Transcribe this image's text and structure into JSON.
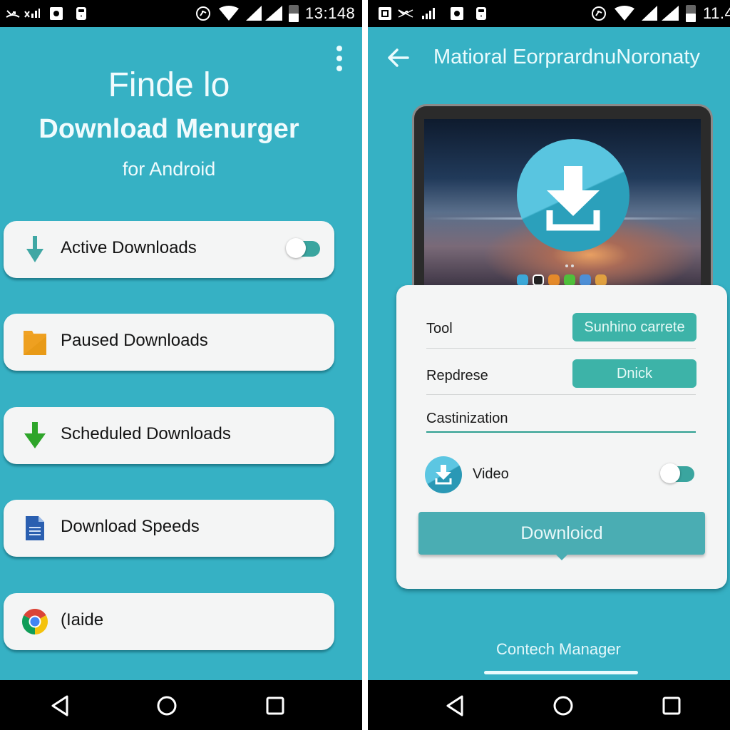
{
  "left_screen": {
    "status_bar": {
      "left_icons": [
        "missed-call-icon",
        "no-signal-icon",
        "gallery-notification-icon",
        "sim-card-icon"
      ],
      "right_icons": [
        "sync-icon",
        "wifi-icon",
        "signal-icon",
        "signal-icon",
        "battery-icon"
      ],
      "time": "13:148"
    },
    "overflow_menu_icon": "more-vert-icon",
    "hero": {
      "line1": "Finde lo",
      "line2": "Download Menurger",
      "line3": "for Android"
    },
    "menu_items": [
      {
        "label": "Active Downloads",
        "icon": "teal-arrow-down-icon",
        "has_toggle": true,
        "toggle_on": true
      },
      {
        "label": "Paused Downloads",
        "icon": "folder-icon"
      },
      {
        "label": "Scheduled Downloads",
        "icon": "green-arrow-down-icon"
      },
      {
        "label": "Download Speeds",
        "icon": "document-icon"
      },
      {
        "label": "(Iaide",
        "icon": "chrome-icon"
      }
    ],
    "nav_bar": {
      "back": "back-icon",
      "home": "home-icon",
      "recents": "recents-icon"
    }
  },
  "right_screen": {
    "status_bar": {
      "left_icons": [
        "gallery-notification-icon",
        "missed-call-icon",
        "signal-bars-icon",
        "gallery-notification-icon",
        "sim-card-icon"
      ],
      "right_icons": [
        "sync-icon",
        "wifi-icon",
        "signal-icon",
        "signal-icon",
        "battery-icon"
      ],
      "time": "11.4"
    },
    "toolbar": {
      "back_icon": "arrow-back-icon",
      "title": "Matioral EorprardnuNoronaty"
    },
    "hero_image": {
      "icon": "download-icon"
    },
    "dialog": {
      "rows": [
        {
          "label": "Tool",
          "button": "Sunhino carrete"
        },
        {
          "label": "Repdrese",
          "button": "Dnick"
        },
        {
          "label": "Castinization"
        }
      ],
      "video_row": {
        "label": "Video",
        "icon": "download-circle-icon",
        "toggle_on": true
      },
      "download_button": "Downloicd"
    },
    "bottom_tab": {
      "label": "Contech Manager"
    },
    "nav_bar": {
      "back": "back-icon",
      "home": "home-icon",
      "recents": "recents-icon"
    }
  },
  "colors": {
    "background": "#36b1c4",
    "card": "#f4f5f5",
    "accent_teal": "#3db3a8",
    "button_teal": "#4aadb3",
    "folder_orange": "#f0a224",
    "scheduled_green": "#2ea52a",
    "doc_blue": "#2a5fb0"
  }
}
